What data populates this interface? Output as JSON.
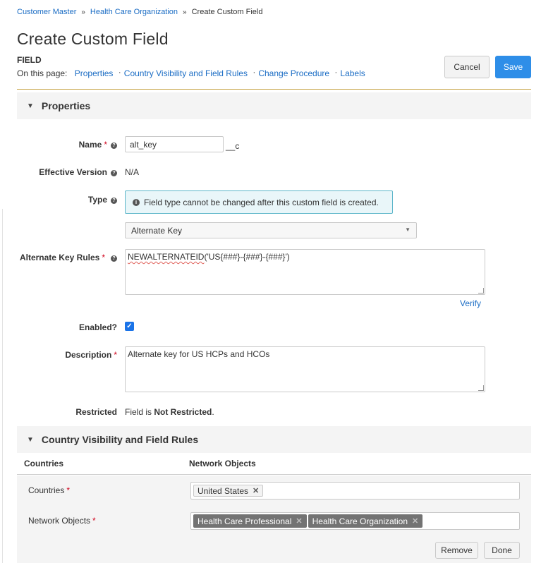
{
  "breadcrumb": {
    "items": [
      "Customer Master",
      "Health Care Organization"
    ],
    "current": "Create Custom Field",
    "separator": "»"
  },
  "page": {
    "title": "Create Custom Field",
    "subtitle": "FIELD",
    "on_this_page_label": "On this page:",
    "anchors": [
      "Properties",
      "Country Visibility and Field Rules",
      "Change Procedure",
      "Labels"
    ],
    "anchor_separator": "·"
  },
  "header_buttons": {
    "cancel": "Cancel",
    "save": "Save"
  },
  "properties": {
    "section_title": "Properties",
    "name": {
      "label": "Name",
      "value": "alt_key",
      "suffix": "__c"
    },
    "effective_version": {
      "label": "Effective Version",
      "value": "N/A"
    },
    "type": {
      "label": "Type",
      "info_text": "Field type cannot be changed after this custom field is created.",
      "selected": "Alternate Key"
    },
    "alternate_key_rules": {
      "label": "Alternate Key Rules",
      "value_fn": "NEWALTERNATEID",
      "value_args": "('US{###}-{###}-{###}')",
      "verify_label": "Verify"
    },
    "enabled": {
      "label": "Enabled?",
      "checked": true
    },
    "description": {
      "label": "Description",
      "value": "Alternate key for US HCPs and HCOs"
    },
    "restricted": {
      "label": "Restricted",
      "prefix": "Field is ",
      "bold": "Not Restricted",
      "suffix": "."
    }
  },
  "country_visibility": {
    "section_title": "Country Visibility and Field Rules",
    "columns": [
      "Countries",
      "Network Objects"
    ],
    "countries": {
      "label": "Countries",
      "tags": [
        "United States"
      ]
    },
    "network_objects": {
      "label": "Network Objects",
      "tags": [
        "Health Care Professional",
        "Health Care Organization"
      ]
    },
    "buttons": {
      "remove": "Remove",
      "done": "Done"
    }
  },
  "colors": {
    "link": "#1a6cc4",
    "save_button": "#2e8ee8",
    "accent_line": "#c8a64a",
    "required": "#d0021b",
    "info_border": "#5bb5c9",
    "info_background": "#e9f6f9",
    "tag_dark": "#737373"
  },
  "icons": {
    "help": "question-circle-icon",
    "info": "info-circle-icon",
    "collapse": "triangle-down-icon",
    "remove_tag": "x-icon"
  }
}
